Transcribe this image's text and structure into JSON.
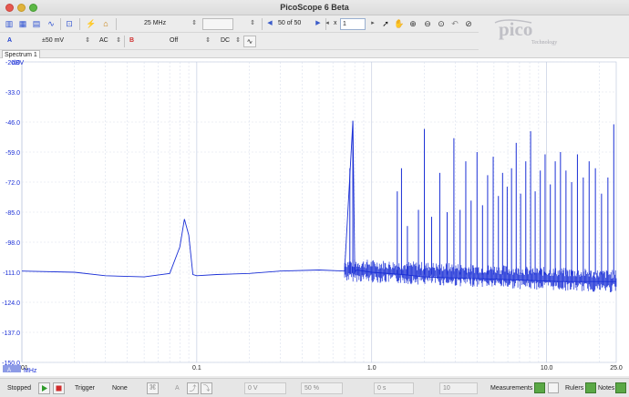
{
  "window": {
    "title": "PicoScope 6 Beta"
  },
  "toolbar1": {
    "timebase": "25 MHz",
    "buffer_nav": "50 of 50",
    "zoom_prefix": "x",
    "zoom_value": "1"
  },
  "toolbar2": {
    "channel_a": "A",
    "range_a": "±50 mV",
    "coupling_a": "AC",
    "channel_b": "B",
    "range_b": "Off",
    "coupling_b": "DC"
  },
  "logo": {
    "text": "pico",
    "subtext": "Technology"
  },
  "tab": {
    "label": "Spectrum 1"
  },
  "plot": {
    "unit": "dBV",
    "x_unit": "MHz",
    "channel_marker": "A"
  },
  "chart_data": {
    "type": "line",
    "title": "",
    "xlabel": "MHz",
    "ylabel": "dBV",
    "x_scale": "log",
    "xlim": [
      0.01,
      25.0
    ],
    "ylim": [
      -150.0,
      -20.0
    ],
    "x_ticks": [
      "0.01",
      "0.1",
      "1.0",
      "10.0",
      "25.0"
    ],
    "y_ticks": [
      "-20.0",
      "-33.0",
      "-46.0",
      "-59.0",
      "-72.0",
      "-85.0",
      "-98.0",
      "-111.0",
      "-124.0",
      "-137.0",
      "-150.0"
    ],
    "grid": true,
    "series_color": "#1a2fd6",
    "series": [
      {
        "name": "",
        "x": [
          0.01,
          0.02,
          0.03,
          0.05,
          0.07,
          0.08,
          0.085,
          0.09,
          0.095,
          0.1,
          0.13,
          0.2,
          0.3,
          0.5,
          0.7,
          0.78,
          0.8,
          0.82,
          1.0,
          1.5,
          2.0,
          3.0,
          5.0,
          8.0,
          12.0,
          18.0,
          25.0
        ],
        "values": [
          -110.5,
          -111.0,
          -112.5,
          -113.0,
          -111.5,
          -100.0,
          -88.0,
          -95.0,
          -112.0,
          -112.5,
          -112.0,
          -111.5,
          -110.5,
          -110.0,
          -110.5,
          -45.5,
          -111.0,
          -110.0,
          -111.0,
          -112.0,
          -113.0,
          -113.5,
          -114.0,
          -114.5,
          -115.0,
          -115.0,
          -115.0
        ]
      }
    ],
    "peaks": [
      {
        "x": 0.78,
        "y": -45.5
      },
      {
        "x": 0.75,
        "y": -66.0
      },
      {
        "x": 1.4,
        "y": -76.0
      },
      {
        "x": 1.48,
        "y": -66.0
      },
      {
        "x": 1.6,
        "y": -91.0
      },
      {
        "x": 1.85,
        "y": -84.0
      },
      {
        "x": 2.0,
        "y": -49.0
      },
      {
        "x": 2.2,
        "y": -87.0
      },
      {
        "x": 2.45,
        "y": -68.0
      },
      {
        "x": 2.7,
        "y": -85.0
      },
      {
        "x": 2.95,
        "y": -53.0
      },
      {
        "x": 3.2,
        "y": -84.0
      },
      {
        "x": 3.45,
        "y": -63.0
      },
      {
        "x": 3.7,
        "y": -80.0
      },
      {
        "x": 4.0,
        "y": -59.0
      },
      {
        "x": 4.3,
        "y": -82.0
      },
      {
        "x": 4.6,
        "y": -69.0
      },
      {
        "x": 4.95,
        "y": -61.0
      },
      {
        "x": 5.3,
        "y": -78.0
      },
      {
        "x": 5.6,
        "y": -68.0
      },
      {
        "x": 5.95,
        "y": -74.0
      },
      {
        "x": 6.3,
        "y": -66.0
      },
      {
        "x": 6.7,
        "y": -55.0
      },
      {
        "x": 7.1,
        "y": -77.0
      },
      {
        "x": 7.6,
        "y": -63.0
      },
      {
        "x": 8.1,
        "y": -50.0
      },
      {
        "x": 8.6,
        "y": -76.0
      },
      {
        "x": 9.2,
        "y": -67.0
      },
      {
        "x": 9.8,
        "y": -60.0
      },
      {
        "x": 10.5,
        "y": -73.0
      },
      {
        "x": 11.2,
        "y": -63.0
      },
      {
        "x": 12.0,
        "y": -59.0
      },
      {
        "x": 12.9,
        "y": -67.0
      },
      {
        "x": 13.9,
        "y": -72.0
      },
      {
        "x": 15.0,
        "y": -60.0
      },
      {
        "x": 16.2,
        "y": -70.0
      },
      {
        "x": 17.5,
        "y": -63.0
      },
      {
        "x": 19.0,
        "y": -66.0
      },
      {
        "x": 20.6,
        "y": -77.0
      },
      {
        "x": 22.4,
        "y": -70.0
      },
      {
        "x": 24.2,
        "y": -47.0
      }
    ]
  },
  "statusbar": {
    "run_state": "Stopped",
    "trigger_label": "Trigger",
    "trigger_mode": "None",
    "trigger_channel": "A",
    "threshold": "0 V",
    "pretrigger": "50 %",
    "delay": "0 s",
    "captures": "10",
    "measurements": "Measurements",
    "rulers": "Rulers",
    "notes": "Notes"
  }
}
